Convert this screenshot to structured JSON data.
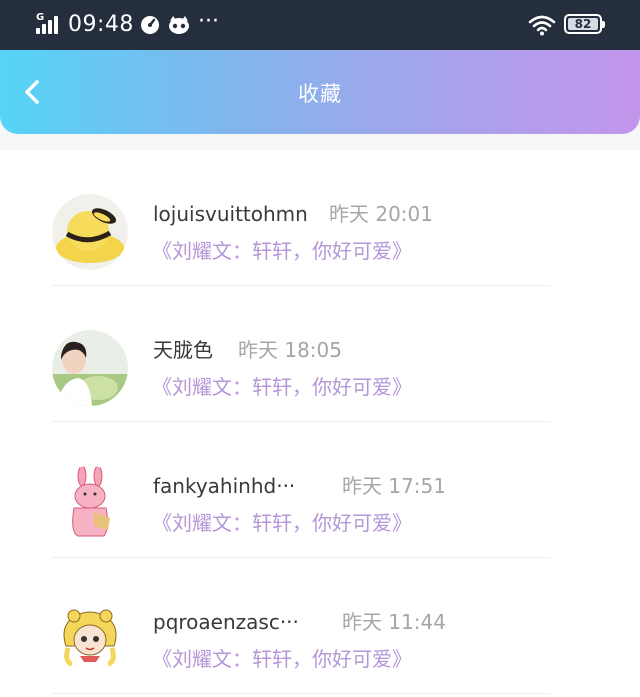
{
  "status_bar": {
    "time": "09:48",
    "network_label": "G",
    "dots": "···",
    "battery": "82"
  },
  "header": {
    "title": "收藏",
    "back_icon": "chevron-left-icon"
  },
  "colors": {
    "status_bar_bg": "#242e3c",
    "header_gradient": [
      "#55d4f5",
      "#c296ea"
    ],
    "quote_color": "#b597d8",
    "time_color": "#a6a6a6"
  },
  "favorites": [
    {
      "name": "lojuisvuittohmn",
      "time": "昨天 20:01",
      "quote": "《刘耀文：轩轩，你好可爱》",
      "avatar": "yellow-hat-avatar"
    },
    {
      "name": "天胧色",
      "time": "昨天 18:05",
      "quote": "《刘耀文：轩轩，你好可爱》",
      "avatar": "person-photo-avatar"
    },
    {
      "name": "fankyahinhd···",
      "time": "昨天 17:51",
      "quote": "《刘耀文：轩轩，你好可爱》",
      "avatar": "pink-rabbit-avatar"
    },
    {
      "name": "pqroaenzasc···",
      "time": "昨天 11:44",
      "quote": "《刘耀文：轩轩，你好可爱》",
      "avatar": "cartoon-girl-avatar"
    }
  ]
}
